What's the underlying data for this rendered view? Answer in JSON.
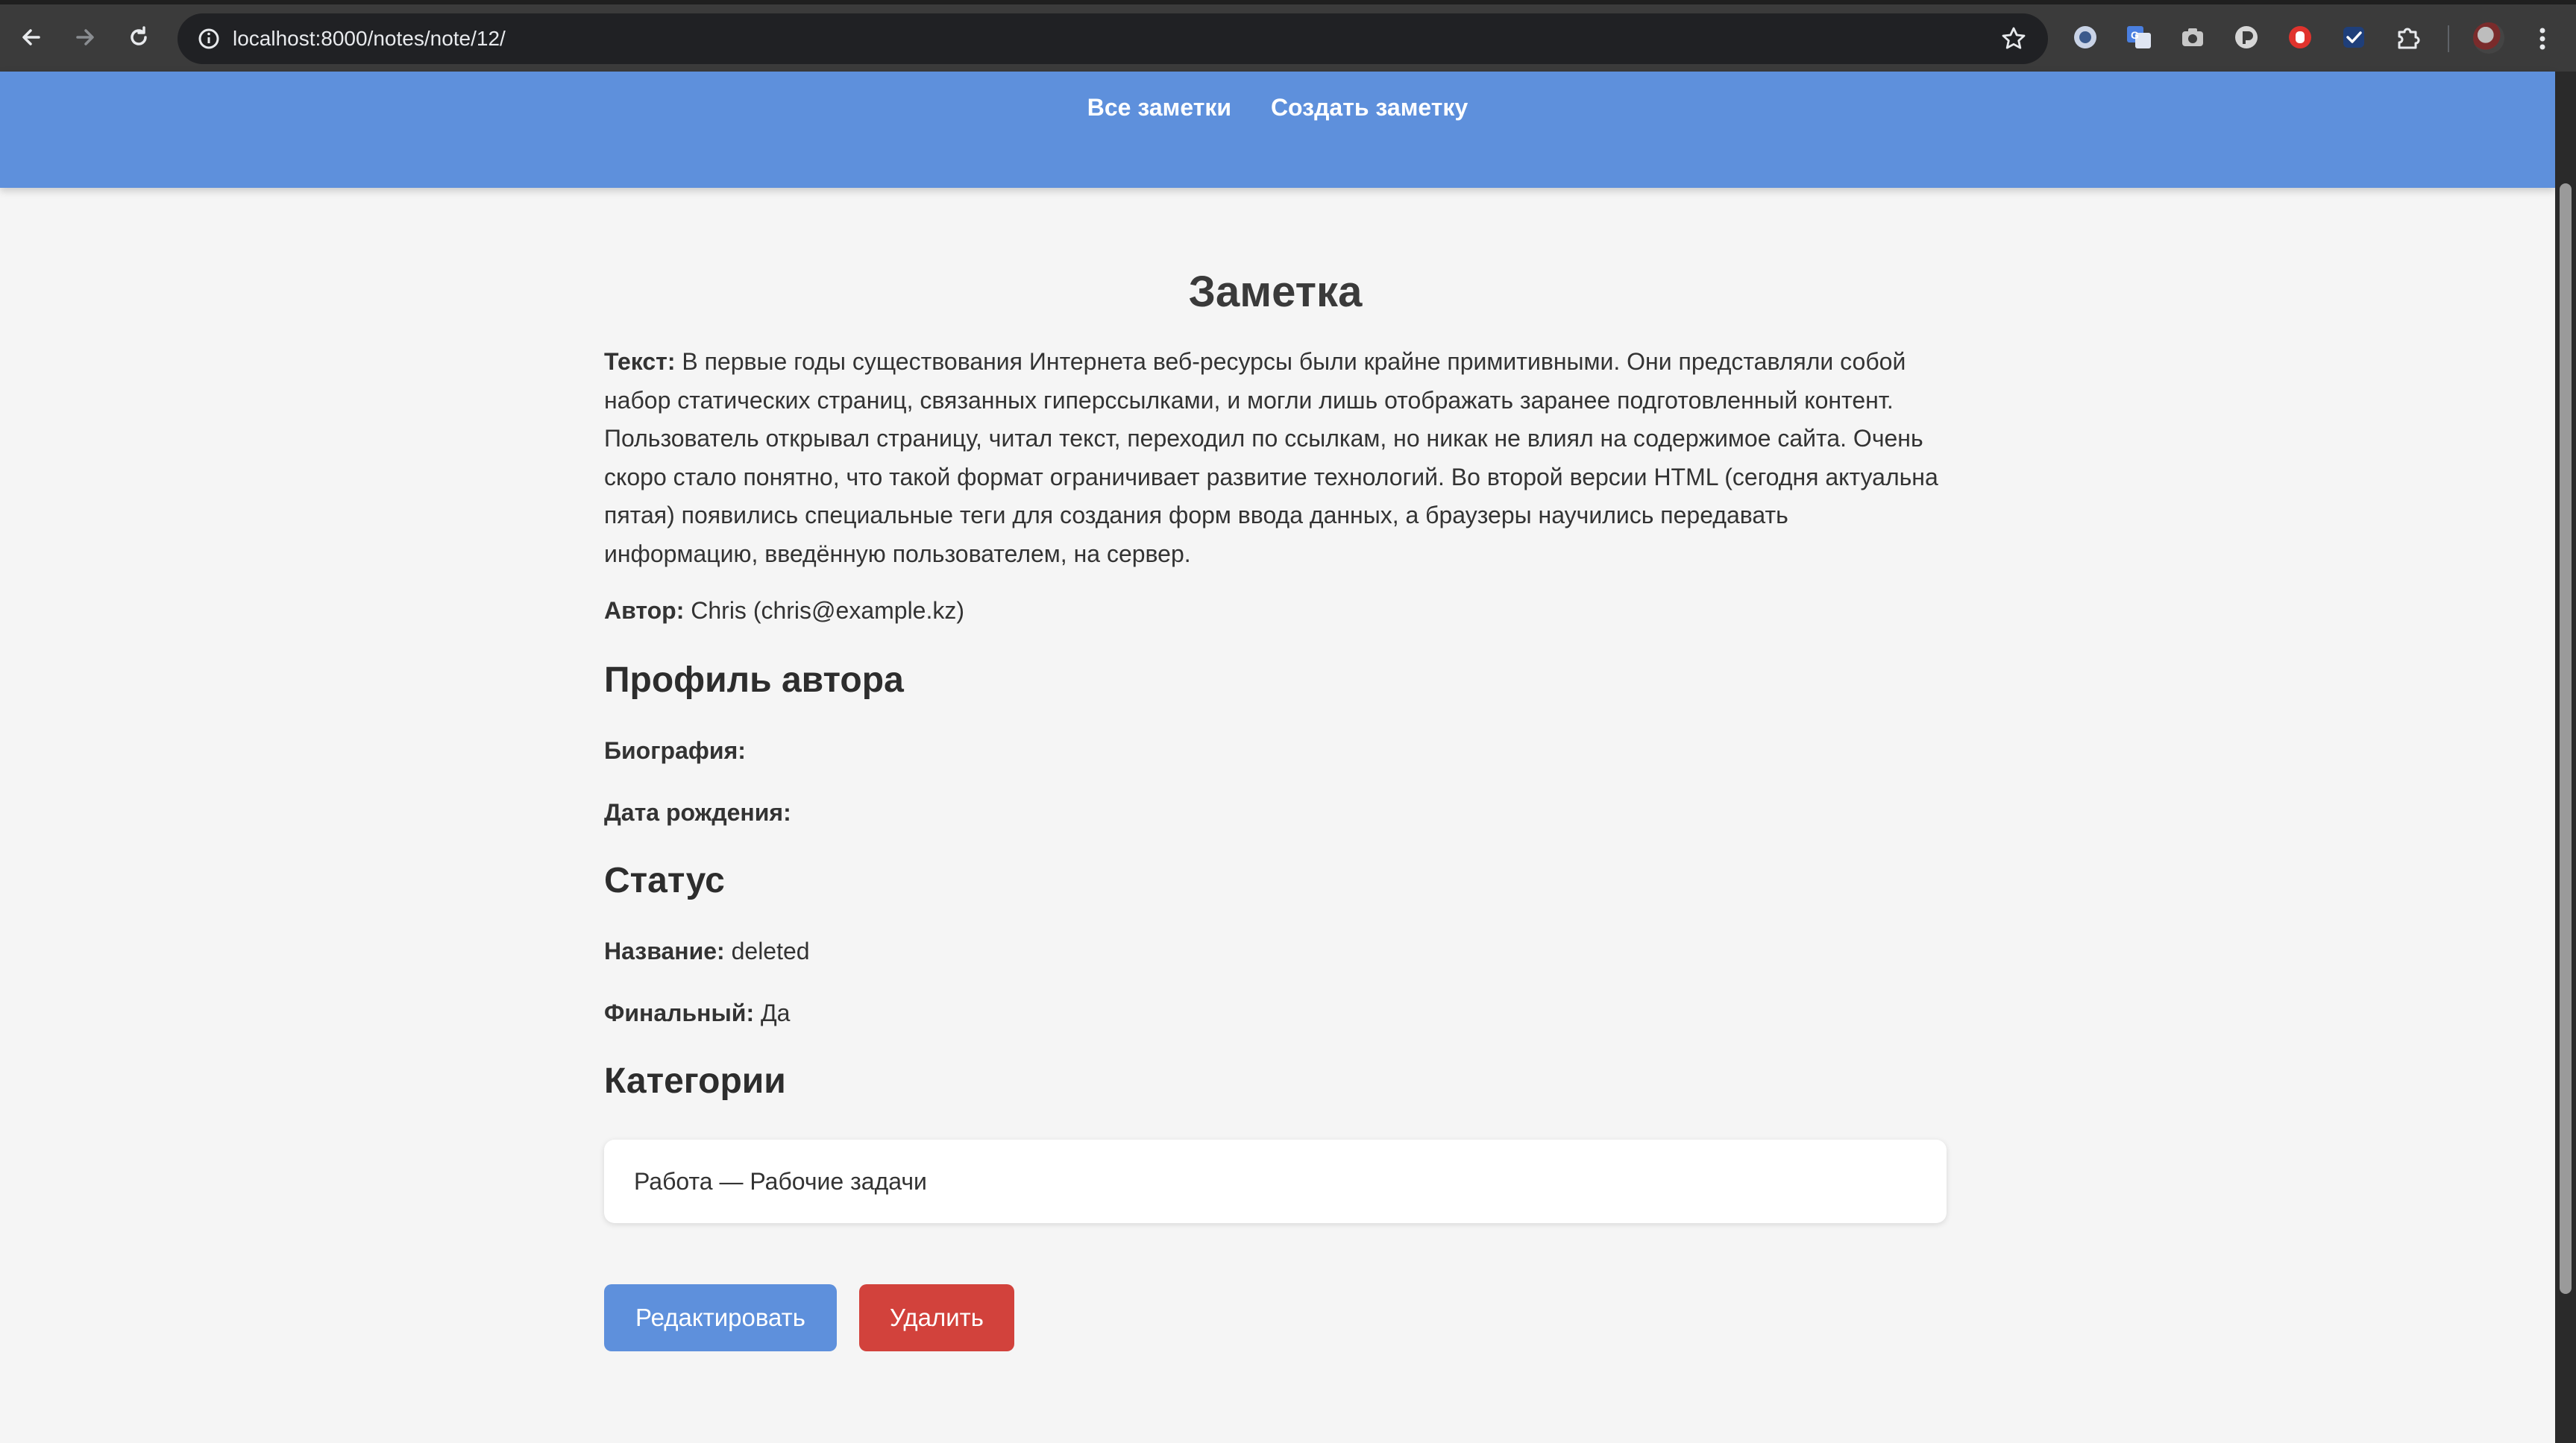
{
  "browser": {
    "url": "localhost:8000/notes/note/12/",
    "extensions": [
      "circle-extension-icon",
      "translate-extension-icon",
      "camera-extension-icon",
      "pocket-extension-icon",
      "red-hand-extension-icon",
      "checkmark-extension-icon",
      "puzzle-icon"
    ]
  },
  "nav": {
    "all_notes": "Все заметки",
    "create_note": "Создать заметку"
  },
  "note": {
    "title": "Заметка",
    "text_label": "Текст:",
    "text": " В первые годы существования Интернета веб-ресурсы были крайне примитивными. Они представляли собой набор статических страниц, связанных гиперссылками, и могли лишь отображать заранее подготовленный контент. Пользователь открывал страницу, читал текст, переходил по ссылкам, но никак не влиял на содержимое сайта. Очень скоро стало понятно, что такой формат ограничивает развитие технологий. Во второй версии HTML (сегодня актуальна пятая) появились специальные теги для создания форм ввода данных, а браузеры научились передавать информацию, введённую пользователем, на сервер.",
    "author_label": "Автор:",
    "author": " Chris (chris@example.kz)"
  },
  "profile": {
    "heading": "Профиль автора",
    "bio_label": "Биография:",
    "bio": "",
    "birth_label": "Дата рождения:",
    "birth": ""
  },
  "status": {
    "heading": "Статус",
    "name_label": "Название:",
    "name": " deleted",
    "final_label": "Финальный:",
    "final": " Да"
  },
  "categories": {
    "heading": "Категории",
    "items": [
      "Работа — Рабочие задачи"
    ]
  },
  "actions": {
    "edit": "Редактировать",
    "delete": "Удалить"
  },
  "colors": {
    "header": "#5e90dc",
    "edit_button": "#5e90dc",
    "delete_button": "#d2423c"
  }
}
